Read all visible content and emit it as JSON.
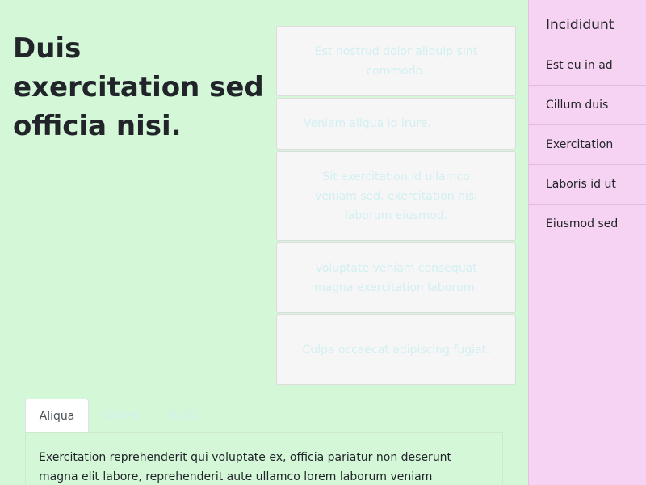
{
  "main": {
    "title": "Duis exercitation sed officia nisi.",
    "cards": [
      "Est nostrud dolor aliquip sint commodo.",
      "Veniam aliqua id irure.",
      "Sit exercitation id ullamco veniam sed, exercitation nisi laborum eiusmod.",
      "Voluptate veniam consequat magna exercitation laborum.",
      "Culpa occaecat adipiscing fugiat."
    ],
    "tabs": [
      {
        "label": "Aliqua"
      },
      {
        "label": "Dolore"
      },
      {
        "label": "Nulla"
      }
    ],
    "tab_content": "Exercitation reprehenderit qui voluptate ex, officia pariatur non deserunt magna elit labore, reprehenderit aute ullamco lorem laborum veniam"
  },
  "sidebar": {
    "title": "Incididunt",
    "items": [
      {
        "label": "Est eu in ad"
      },
      {
        "label": "Cillum duis"
      },
      {
        "label": "Exercitation"
      },
      {
        "label": "Laboris id ut"
      },
      {
        "label": "Eiusmod sed"
      }
    ]
  },
  "colors": {
    "main_bg": "#d4f7d8",
    "sidebar_bg": "#f6d3f2",
    "card_bg": "#f6f6f6",
    "faint_text": "#d2eff2"
  }
}
